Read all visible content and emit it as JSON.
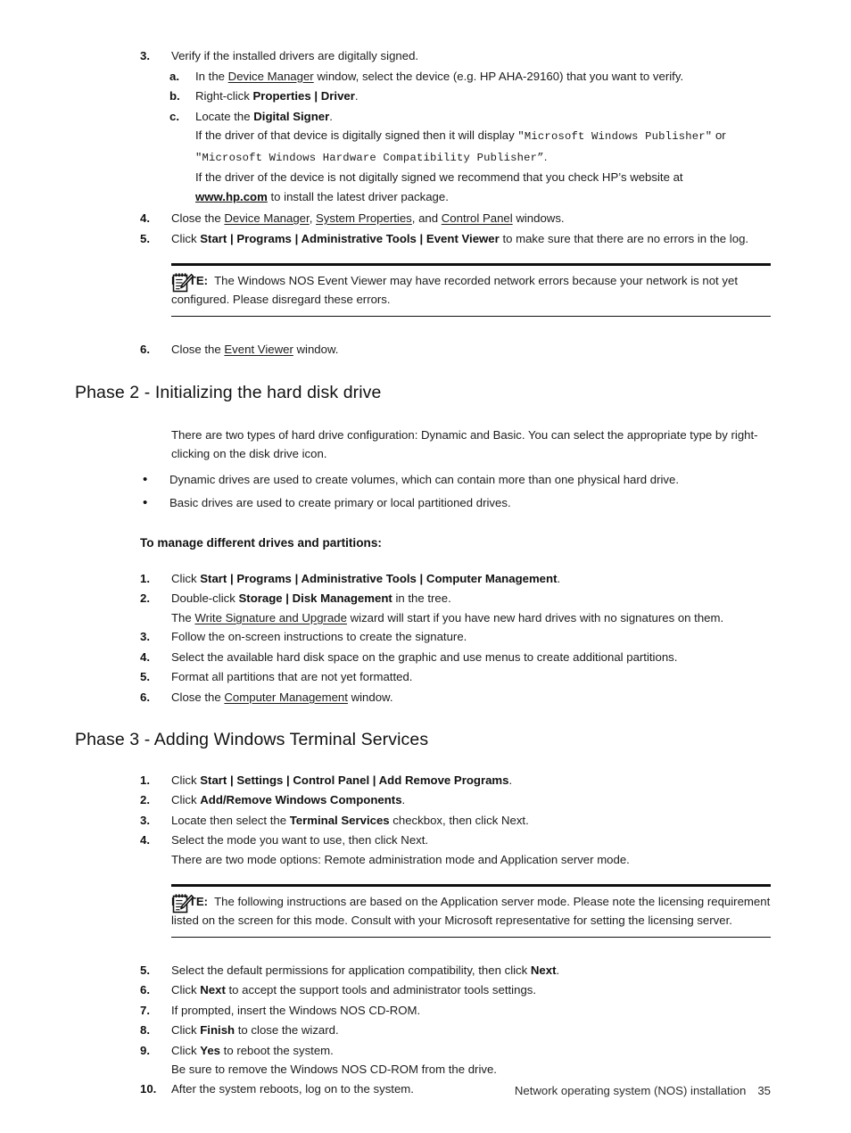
{
  "document": {
    "footer_text": "Network operating system (NOS) installation",
    "page_number": "35"
  },
  "section_step3": {
    "marker": "3.",
    "text": "Verify if the installed drivers are digitally signed.",
    "sub_items": [
      {
        "marker": "a.",
        "pre": "In the ",
        "underlined": "Device Manager",
        "post": " window, select the device (e.g. HP AHA-29160) that you want to verify."
      },
      {
        "marker": "b.",
        "pre": "Right-click ",
        "bold1": "Properties",
        "sep": " | ",
        "bold2": "Driver",
        "post": "."
      },
      {
        "marker": "c.",
        "pre": "Locate the ",
        "bold1": "Digital Signer",
        "post": "."
      }
    ],
    "signed_paragraph": {
      "pre": "If the driver of that device is digitally signed then it will display ",
      "quote_open1": "\"",
      "mono1": "Microsoft Windows Publisher",
      "quote_close1": "\"",
      "middle": " or ",
      "quote_open2": "\"",
      "mono2": "Microsoft Windows Hardware Compatibility Publisher",
      "quote_close2": "”",
      "post": "."
    },
    "unsigned_paragraph": {
      "pre": "If the driver of the device is not digitally signed we recommend that you check HP’s website at ",
      "link": "www.hp.com",
      "post": " to install the latest driver package."
    }
  },
  "section_step4": {
    "marker": "4.",
    "pre": "Close the ",
    "u1": "Device Manager",
    "mid1": ", ",
    "u2": "System Properties",
    "mid2": ", and ",
    "u3": "Control Panel",
    "post": " windows."
  },
  "section_step5": {
    "marker": "5.",
    "pre": "Click ",
    "b1": "Start",
    "s1": " | ",
    "b2": "Programs",
    "s2": " | ",
    "b3": "Administrative Tools",
    "s3": " | ",
    "b4": "Event Viewer",
    "post": " to make sure that there are no errors in the log."
  },
  "note1": {
    "icon": "note-pencil-icon",
    "label": "NOTE:",
    "text": "The Windows NOS Event Viewer may have recorded network errors because your network is not yet configured. Please disregard these errors."
  },
  "section_step6": {
    "marker": "6.",
    "pre": "Close the ",
    "u1": "Event Viewer",
    "post": " window."
  },
  "phase2": {
    "heading": "Phase 2 - Initializing the hard disk drive",
    "intro": "There are two types of hard drive configuration: Dynamic and Basic. You can select the appropriate type by right-clicking on the disk drive icon.",
    "bullets": [
      {
        "marker": "•",
        "text": "Dynamic drives are used to create volumes, which can contain more than one physical hard drive."
      },
      {
        "marker": "•",
        "text": "Basic drives are used to create primary or local partitioned drives."
      }
    ],
    "sub_heading": "To manage different drives and partitions:",
    "steps": [
      {
        "marker": "1.",
        "pre": "Click ",
        "b1": "Start",
        "s1": " | ",
        "b2": "Programs",
        "s2": " | ",
        "b3": "Administrative Tools",
        "s3": " | ",
        "b4": "Computer Management",
        "post": "."
      },
      {
        "marker": "2.",
        "pre": "Double-click ",
        "b1": "Storage",
        "s1": " | ",
        "b2": "Disk Management",
        "post": " in the tree."
      }
    ],
    "step2_note": {
      "pre": "The ",
      "u1": "Write Signature and Upgrade",
      "post": " wizard will start if you have new hard drives with no signatures on them."
    },
    "steps_rest": [
      {
        "marker": "3.",
        "text": "Follow the on-screen instructions to create the signature."
      },
      {
        "marker": "4.",
        "text": "Select the available hard disk space on the graphic and use menus to create additional partitions."
      },
      {
        "marker": "5.",
        "text": "Format all partitions that are not yet formatted."
      }
    ],
    "step6": {
      "marker": "6.",
      "pre": "Close the ",
      "u1": "Computer Management",
      "post": " window."
    }
  },
  "phase3": {
    "heading": "Phase 3 - Adding Windows Terminal Services",
    "step1": {
      "marker": "1.",
      "pre": "Click ",
      "b1": "Start",
      "s1": " | ",
      "b2": "Settings",
      "s2": " | ",
      "b3": "Control Panel",
      "s3": " | ",
      "b4": "Add Remove Programs",
      "post": "."
    },
    "step2": {
      "marker": "2.",
      "pre": "Click ",
      "b1": "Add/Remove Windows Components",
      "post": "."
    },
    "step3": {
      "marker": "3.",
      "pre": "Locate then select the ",
      "b1": "Terminal Services",
      "post": " checkbox, then click Next."
    },
    "step4": {
      "marker": "4.",
      "text": "Select the mode you want to use, then click Next."
    },
    "step4_note": "There are two mode options: Remote administration mode and Application server mode.",
    "note2": {
      "icon": "note-pencil-icon",
      "label": "NOTE:",
      "text": "The following instructions are based on the Application server mode. Please note the licensing requirement listed on the screen for this mode. Consult with your Microsoft representative for setting the licensing server."
    },
    "step5": {
      "marker": "5.",
      "pre": "Select the default permissions for application compatibility, then click ",
      "b1": "Next",
      "post": "."
    },
    "step6": {
      "marker": "6.",
      "pre": "Click ",
      "b1": "Next",
      "post": " to accept the support tools and administrator tools settings."
    },
    "step7": {
      "marker": "7.",
      "text": "If prompted, insert the Windows NOS CD-ROM."
    },
    "step8": {
      "marker": "8.",
      "pre": "Click ",
      "b1": "Finish",
      "post": " to close the wizard."
    },
    "step9": {
      "marker": "9.",
      "pre": "Click ",
      "b1": "Yes",
      "post": " to reboot the system."
    },
    "step9_note": "Be sure to remove the Windows NOS CD-ROM from the drive.",
    "step10": {
      "marker": "10.",
      "text": "After the system reboots, log on to the system."
    }
  }
}
